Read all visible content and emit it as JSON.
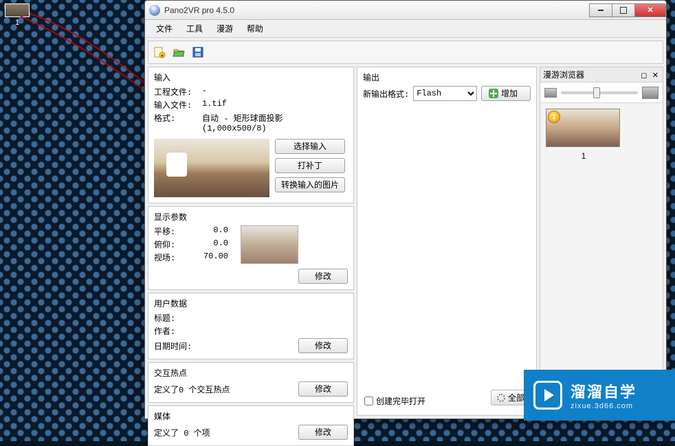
{
  "desktop": {
    "icon_label": "1"
  },
  "window": {
    "title": "Pano2VR pro 4.5.0",
    "menus": [
      "文件",
      "工具",
      "漫游",
      "帮助"
    ]
  },
  "input_panel": {
    "title": "输入",
    "project_file_label": "工程文件:",
    "project_file_value": "-",
    "input_file_label": "输入文件:",
    "input_file_value": "1.tif",
    "format_label": "格式:",
    "format_value": "自动 - 矩形球面投影 (1,000x500/8)",
    "select_input_btn": "选择输入",
    "patch_btn": "打补丁",
    "convert_btn": "转换输入的图片"
  },
  "display_panel": {
    "title": "显示参数",
    "pan_label": "平移:",
    "pan_value": "0.0",
    "tilt_label": "俯仰:",
    "tilt_value": "0.0",
    "fov_label": "视场:",
    "fov_value": "70.00",
    "modify_btn": "修改"
  },
  "userdata_panel": {
    "title": "用户数据",
    "title_label": "标题:",
    "author_label": "作者:",
    "datetime_label": "日期时间:",
    "modify_btn": "修改"
  },
  "hotspot_panel": {
    "title": "交互热点",
    "defined_text": "定义了0 个交互热点",
    "modify_btn": "修改"
  },
  "media_panel": {
    "title": "媒体",
    "defined_text": "定义了 0 个项",
    "modify_btn": "修改"
  },
  "output_panel": {
    "title": "输出",
    "new_format_label": "新输出格式:",
    "format_options": [
      "Flash"
    ],
    "add_btn": "增加",
    "open_when_done_label": "创建完毕打开"
  },
  "bottom": {
    "all_btn": "全部"
  },
  "browser_panel": {
    "title": "漫游浏览器",
    "thumb_caption": "1",
    "badge": "1"
  },
  "watermark": {
    "line1": "溜溜自学",
    "line2": "zixue.3d66.com"
  }
}
